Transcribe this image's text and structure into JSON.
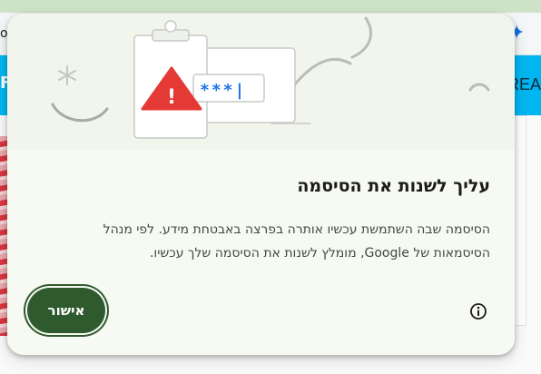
{
  "background": {
    "top_bar_left_text": "ol",
    "banner_left_fragment": "F",
    "banner_right_fragment": "REA"
  },
  "dialog": {
    "illustration": {
      "masked_password": "***|",
      "warning_symbol": "!"
    },
    "title": "עליך לשנות את הסיסמה",
    "body_lines": [
      "הסיסמה שבה השתמשת עכשיו אותרה בפרצה באבטחת מידע. לפי מנהל",
      "הסיסמאות של Google, מומלץ לשנות את הסיסמה שלך עכשיו."
    ],
    "ok_button_label": "אישור",
    "info_icon": "info-icon"
  },
  "colors": {
    "dialog_bg": "#f7faf2",
    "button_bg": "#2f5a2e",
    "banner_bg": "#00b6f1",
    "warning_red": "#e53935",
    "password_blue": "#1a73e8"
  }
}
